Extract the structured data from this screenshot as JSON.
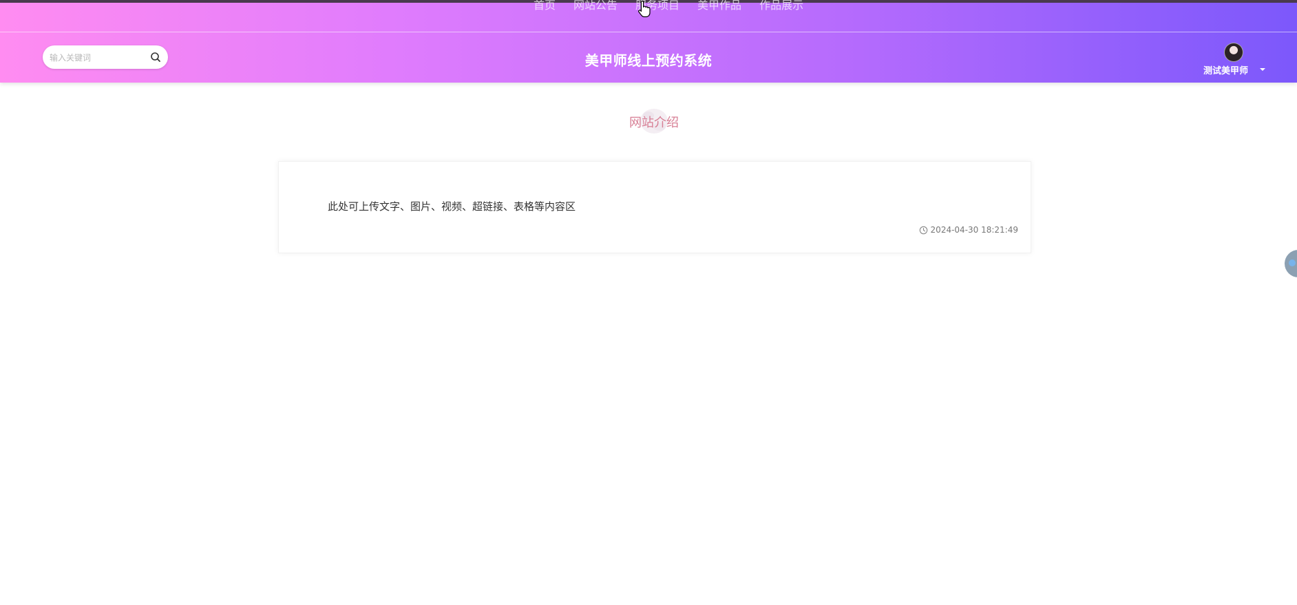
{
  "nav": {
    "items": [
      "首页",
      "网站公告",
      "服务项目",
      "美甲作品",
      "作品展示"
    ]
  },
  "search": {
    "placeholder": "输入关键词"
  },
  "site": {
    "title": "美甲师线上预约系统"
  },
  "user": {
    "name": "测试美甲师"
  },
  "section": {
    "title": "网站介绍"
  },
  "content": {
    "text": "此处可上传文字、图片、视频、超链接、表格等内容区",
    "timestamp": "2024-04-30 18:21:49"
  },
  "colors": {
    "header_start": "#ff8cf1",
    "header_end": "#7c58fb",
    "section_title": "#d77f95"
  },
  "icons": {
    "search": "search-icon",
    "clock": "clock-icon",
    "caret": "caret-down-icon",
    "cursor": "hand-cursor-icon"
  }
}
